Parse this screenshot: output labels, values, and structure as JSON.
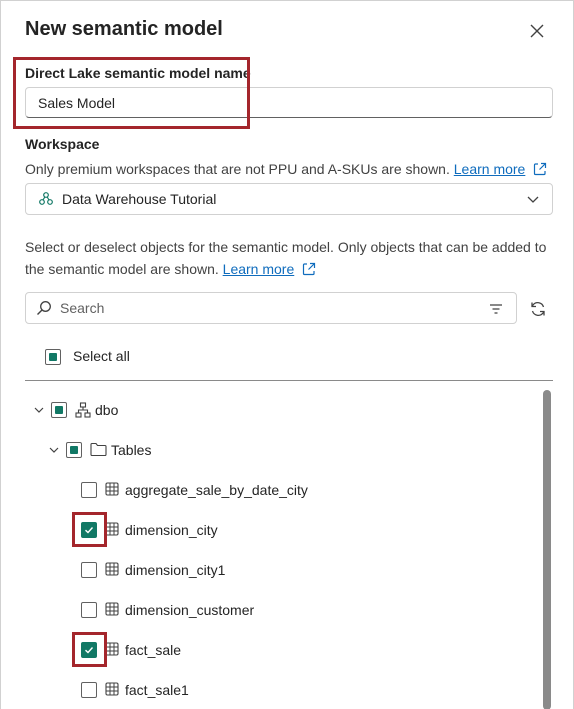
{
  "dialog": {
    "title": "New semantic model",
    "name_label": "Direct Lake semantic model name",
    "name_value": "Sales Model",
    "workspace_label": "Workspace",
    "workspace_desc": "Only premium workspaces that are not PPU and A-SKUs are shown.",
    "learn_more": "Learn more",
    "workspace_value": "Data Warehouse Tutorial",
    "objects_desc_line1": "Select or deselect objects for the semantic model. Only objects that can be added to",
    "objects_desc_line2": "the semantic model are shown.",
    "search_placeholder": "Search",
    "select_all": "Select all"
  },
  "tree": {
    "schema": "dbo",
    "folder": "Tables",
    "tables": [
      {
        "name": "aggregate_sale_by_date_city",
        "checked": false
      },
      {
        "name": "dimension_city",
        "checked": true
      },
      {
        "name": "dimension_city1",
        "checked": false
      },
      {
        "name": "dimension_customer",
        "checked": false
      },
      {
        "name": "fact_sale",
        "checked": true
      },
      {
        "name": "fact_sale1",
        "checked": false
      }
    ]
  },
  "colors": {
    "accent": "#117865",
    "link": "#0f6cbd",
    "annotation": "#a4262c"
  }
}
